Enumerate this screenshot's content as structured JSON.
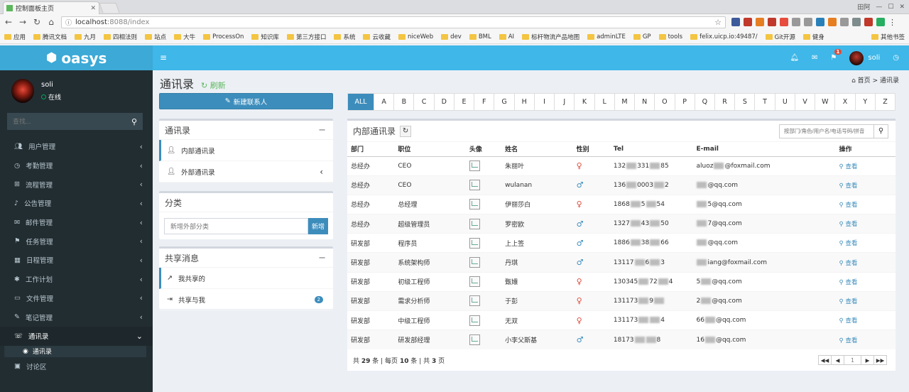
{
  "browser": {
    "tab_title": "控制面板主页",
    "url_host": "localhost",
    "url_rest": ":8088/index",
    "user_label": "田阿",
    "bookmarks": [
      "应用",
      "腾讯文档",
      "九月",
      "四相法则",
      "站点",
      "大牛",
      "ProcessOn",
      "知识库",
      "第三方接口",
      "系统",
      "云收藏",
      "niceWeb",
      "dev",
      "BML",
      "AI",
      "标杆物流产品地图",
      "adminLTE",
      "GP",
      "tools",
      "felix.uicp.io:49487/",
      "Git开源",
      "健身"
    ],
    "other_bookmarks": "其他书签"
  },
  "header": {
    "logo": "oasys",
    "user": "soli",
    "mail_badge": "1"
  },
  "sidebar": {
    "user_name": "soli",
    "status": "在线",
    "search_placeholder": "查找...",
    "items": [
      {
        "label": "用户管理"
      },
      {
        "label": "考勤管理"
      },
      {
        "label": "流程管理"
      },
      {
        "label": "公告管理"
      },
      {
        "label": "邮件管理"
      },
      {
        "label": "任务管理"
      },
      {
        "label": "日程管理"
      },
      {
        "label": "工作计划"
      },
      {
        "label": "文件管理"
      },
      {
        "label": "笔记管理"
      },
      {
        "label": "通讯录"
      }
    ],
    "sub_item": "通讯录",
    "last_item": "讨论区"
  },
  "page": {
    "title": "通讯录",
    "refresh": "刷新",
    "crumb_home": "首页",
    "crumb_sep": ">",
    "crumb_current": "通讯录",
    "new_contact": "新建联系人"
  },
  "addrbook": {
    "title": "通讯录",
    "internal": "内部通讯录",
    "external": "外部通讯录"
  },
  "category": {
    "title": "分类",
    "placeholder": "新增外部分类",
    "button": "新增"
  },
  "share": {
    "title": "共享消息",
    "mine": "我共享的",
    "with_me": "共享与我",
    "with_me_count": "2"
  },
  "letters": [
    "ALL",
    "A",
    "B",
    "C",
    "D",
    "E",
    "F",
    "G",
    "H",
    "I",
    "J",
    "K",
    "L",
    "M",
    "N",
    "O",
    "P",
    "Q",
    "R",
    "S",
    "T",
    "U",
    "V",
    "W",
    "X",
    "Y",
    "Z"
  ],
  "table": {
    "title": "内部通讯录",
    "search_placeholder": "按部门/角色/用户名/电话号码/拼音",
    "columns": [
      "部门",
      "职位",
      "头像",
      "姓名",
      "性别",
      "Tel",
      "E-mail",
      "操作"
    ],
    "view_label": "查看",
    "rows": [
      {
        "dept": "总经办",
        "pos": "CEO",
        "name": "朱丽叶",
        "sex": "female",
        "tel_a": "132",
        "tel_b": "331",
        "tel_c": "85",
        "mail_a": "aluoz",
        "mail_b": "@foxmail.com"
      },
      {
        "dept": "总经办",
        "pos": "CEO",
        "name": "wulanan",
        "sex": "male",
        "tel_a": "136",
        "tel_b": "0003",
        "tel_c": "2",
        "mail_a": "",
        "mail_b": "@qq.com"
      },
      {
        "dept": "总经办",
        "pos": "总经理",
        "name": "伊丽莎白",
        "sex": "female",
        "tel_a": "1868",
        "tel_b": "5",
        "tel_c": "54",
        "mail_a": "",
        "mail_b": "5@qq.com"
      },
      {
        "dept": "总经办",
        "pos": "超级管理员",
        "name": "罗密欧",
        "sex": "male",
        "tel_a": "1327",
        "tel_b": "43",
        "tel_c": "50",
        "mail_a": "",
        "mail_b": "7@qq.com"
      },
      {
        "dept": "研发部",
        "pos": "程序员",
        "name": "上上签",
        "sex": "male",
        "tel_a": "1886",
        "tel_b": "38",
        "tel_c": "66",
        "mail_a": "",
        "mail_b": "@qq.com"
      },
      {
        "dept": "研发部",
        "pos": "系统架构师",
        "name": "丹琪",
        "sex": "male",
        "tel_a": "13117",
        "tel_b": "6",
        "tel_c": "3",
        "mail_a": "",
        "mail_b": "iang@foxmail.com"
      },
      {
        "dept": "研发部",
        "pos": "初级工程师",
        "name": "甄嬛",
        "sex": "female",
        "tel_a": "130345",
        "tel_b": "72",
        "tel_c": "4",
        "mail_a": "5",
        "mail_b": "@qq.com"
      },
      {
        "dept": "研发部",
        "pos": "需求分析师",
        "name": "于彭",
        "sex": "female",
        "tel_a": "131173",
        "tel_b": "9",
        "tel_c": "",
        "mail_a": "2",
        "mail_b": "@qq.com"
      },
      {
        "dept": "研发部",
        "pos": "中级工程师",
        "name": "无双",
        "sex": "female",
        "tel_a": "131173",
        "tel_b": "",
        "tel_c": "4",
        "mail_a": "66",
        "mail_b": "@qq.com"
      },
      {
        "dept": "研发部",
        "pos": "研发部经理",
        "name": "小李父斯基",
        "sex": "male",
        "tel_a": "18173",
        "tel_b": "",
        "tel_c": "8",
        "mail_a": "16",
        "mail_b": "@qq.com"
      }
    ],
    "footer": {
      "t1": "共",
      "total": "29",
      "t2": "条 | 每页",
      "per_page": "10",
      "t3": "条 | 共",
      "pages": "3",
      "t4": "页"
    },
    "current_page": "1"
  }
}
